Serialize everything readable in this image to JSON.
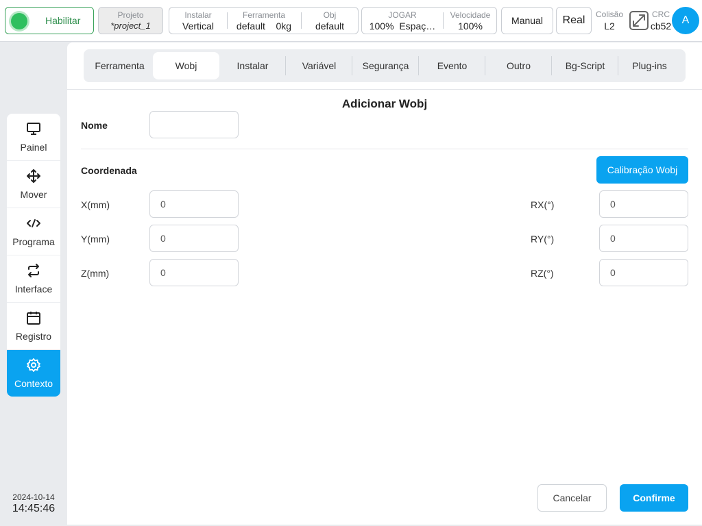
{
  "topbar": {
    "enable_label": "Habilitar",
    "project": {
      "caption": "Projeto",
      "value": "*project_1"
    },
    "install": {
      "caption": "Instalar",
      "value": "Vertical"
    },
    "tool": {
      "caption": "Ferramenta",
      "value": "default",
      "weight": "0kg"
    },
    "obj": {
      "caption": "Obj",
      "value": "default"
    },
    "jog": {
      "caption": "JOGAR",
      "value": "100%",
      "space": "Espaç…"
    },
    "speed": {
      "caption": "Velocidade",
      "value": "100%"
    },
    "mode_label": "Manual",
    "real_label": "Real",
    "collision": {
      "caption": "Colisão",
      "value": "L2"
    },
    "crc": {
      "caption": "CRC",
      "value": "cb52"
    },
    "avatar_letter": "A"
  },
  "sidebar": {
    "items": [
      {
        "label": "Painel",
        "icon": "monitor-icon"
      },
      {
        "label": "Mover",
        "icon": "move-icon"
      },
      {
        "label": "Programa",
        "icon": "code-icon"
      },
      {
        "label": "Interface",
        "icon": "swap-icon"
      },
      {
        "label": "Registro",
        "icon": "calendar-icon"
      },
      {
        "label": "Contexto",
        "icon": "gear-icon"
      }
    ],
    "active": "Contexto"
  },
  "datetime": {
    "date": "2024-10-14",
    "time": "14:45:46"
  },
  "tabs": [
    "Ferramenta",
    "Wobj",
    "Instalar",
    "Variável",
    "Segurança",
    "Evento",
    "Outro",
    "Bg-Script",
    "Plug-ins"
  ],
  "active_tab": "Wobj",
  "form": {
    "title": "Adicionar Wobj",
    "name_label": "Nome",
    "name_value": "",
    "coord_label": "Coordenada",
    "calibration_button": "Calibração Wobj",
    "fields": {
      "x": {
        "label": "X(mm)",
        "value": "0"
      },
      "y": {
        "label": "Y(mm)",
        "value": "0"
      },
      "z": {
        "label": "Z(mm)",
        "value": "0"
      },
      "rx": {
        "label": "RX(°)",
        "value": "0"
      },
      "ry": {
        "label": "RY(°)",
        "value": "0"
      },
      "rz": {
        "label": "RZ(°)",
        "value": "0"
      }
    },
    "cancel_button": "Cancelar",
    "confirm_button": "Confirme"
  },
  "colors": {
    "accent": "#0aa3f0",
    "enable_green": "#2fbf5f"
  }
}
